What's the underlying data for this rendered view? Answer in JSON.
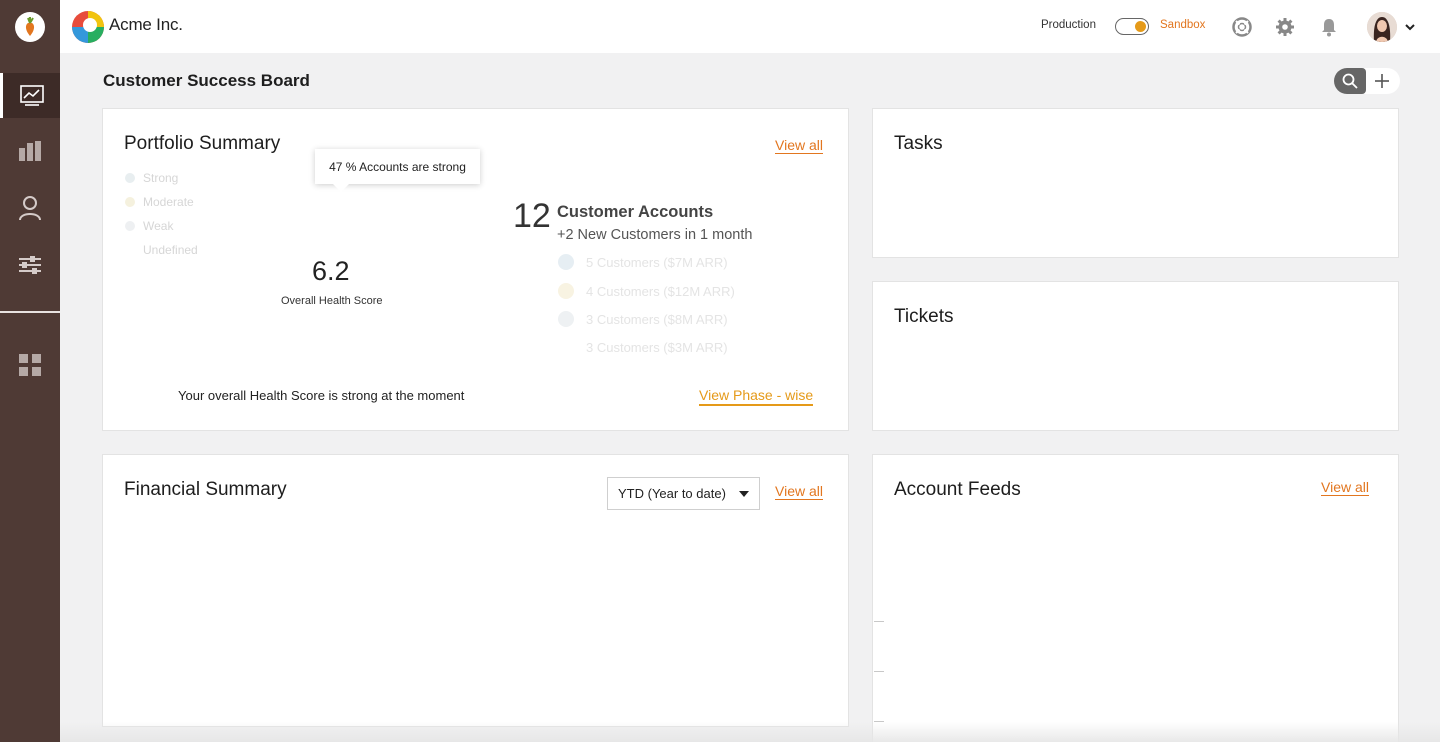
{
  "brand": {
    "name": "Acme Inc."
  },
  "env": {
    "production": "Production",
    "sandbox": "Sandbox"
  },
  "icons": {
    "nav": [
      "dashboard-chart-icon",
      "buildings-icon",
      "user-icon",
      "sliders-icon",
      "apps-grid-icon"
    ],
    "header": [
      "help-lifebuoy-icon",
      "gear-icon",
      "bell-icon"
    ]
  },
  "colors": {
    "sidebar": "#4f3a35",
    "accent": "#e2761f",
    "toggle_knob": "#e59a19"
  },
  "page": {
    "title": "Customer Success Board"
  },
  "portfolio": {
    "title": "Portfolio Summary",
    "view_all": "View all",
    "tooltip": "47 % Accounts are strong",
    "legend": [
      "Strong",
      "Moderate",
      "Weak",
      "Undefined"
    ],
    "score": "6.2",
    "score_label": "Overall Health Score",
    "accounts_count": "12",
    "accounts_title": "Customer Accounts",
    "accounts_sub": "+2 New Customers in 1 month",
    "segments": [
      "5 Customers ($7M ARR)",
      "4 Customers ($12M ARR)",
      "3 Customers ($8M ARR)",
      "3 Customers ($3M ARR)"
    ],
    "health_message": "Your overall Health Score is strong at the moment",
    "phase_link": "View  Phase - wise"
  },
  "tasks": {
    "title": "Tasks"
  },
  "tickets": {
    "title": "Tickets"
  },
  "financial": {
    "title": "Financial Summary",
    "period": "YTD (Year to date)",
    "view_all": "View all"
  },
  "feeds": {
    "title": "Account Feeds",
    "view_all": "View all"
  }
}
